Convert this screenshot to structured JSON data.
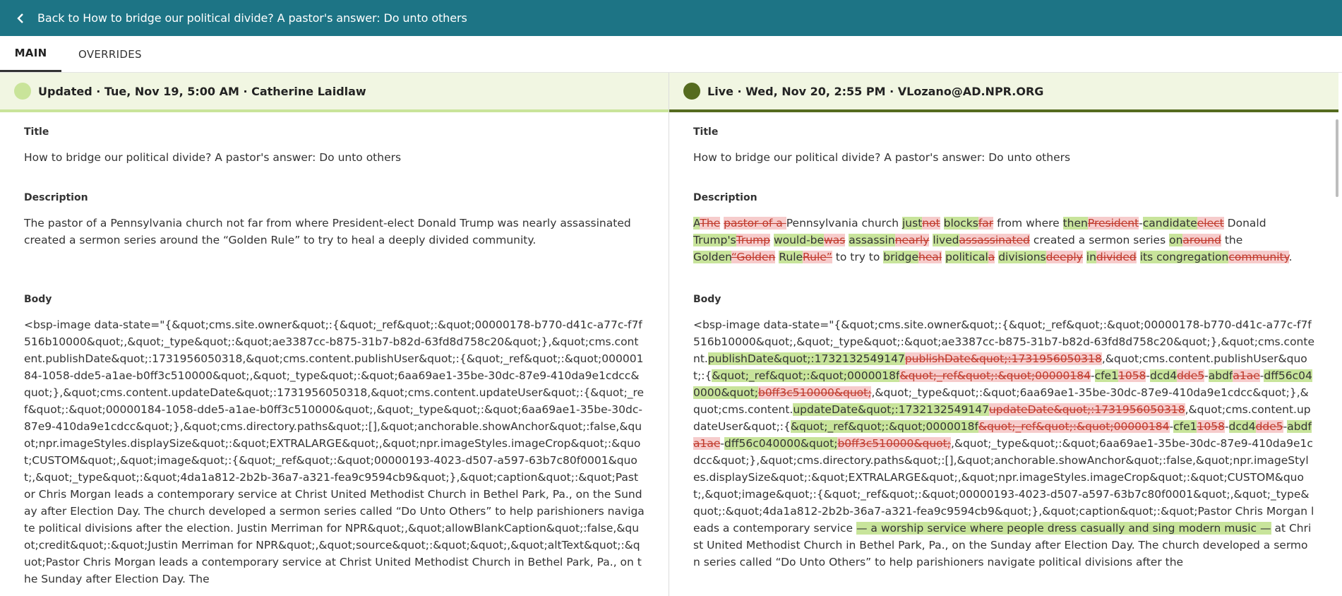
{
  "header": {
    "back_label": "Back to How to bridge our political divide? A pastor's answer: Do unto others"
  },
  "tabs": [
    {
      "label": "MAIN"
    },
    {
      "label": "OVERRIDES"
    }
  ],
  "left": {
    "status": "Updated · Tue, Nov 19, 5:00 AM · Catherine Laidlaw",
    "title_label": "Title",
    "title_value": "How to bridge our political divide? A pastor's answer: Do unto others",
    "description_label": "Description",
    "description_value": "The pastor of a Pennsylvania church not far from where President-elect Donald Trump was nearly assassinated created a sermon series around the “Golden Rule” to try to heal a deeply divided community.",
    "body_label": "Body",
    "body_value": "<bsp-image data-state=\"{&quot;cms.site.owner&quot;:{&quot;_ref&quot;:&quot;00000178-b770-d41c-a77c-f7f516b10000&quot;,&quot;_type&quot;:&quot;ae3387cc-b875-31b7-b82d-63fd8d758c20&quot;},&quot;cms.content.publishDate&quot;:1731956050318,&quot;cms.content.publishUser&quot;:{&quot;_ref&quot;:&quot;00000184-1058-dde5-a1ae-b0ff3c510000&quot;,&quot;_type&quot;:&quot;6aa69ae1-35be-30dc-87e9-410da9e1cdcc&quot;},&quot;cms.content.updateDate&quot;:1731956050318,&quot;cms.content.updateUser&quot;:{&quot;_ref&quot;:&quot;00000184-1058-dde5-a1ae-b0ff3c510000&quot;,&quot;_type&quot;:&quot;6aa69ae1-35be-30dc-87e9-410da9e1cdcc&quot;},&quot;cms.directory.paths&quot;:[],&quot;anchorable.showAnchor&quot;:false,&quot;npr.imageStyles.displaySize&quot;:&quot;EXTRALARGE&quot;,&quot;npr.imageStyles.imageCrop&quot;:&quot;CUSTOM&quot;,&quot;image&quot;:{&quot;_ref&quot;:&quot;00000193-4023-d507-a597-63b7c80f0001&quot;,&quot;_type&quot;:&quot;4da1a812-2b2b-36a7-a321-fea9c9594cb9&quot;},&quot;caption&quot;:&quot;Pastor Chris Morgan leads a contemporary service at Christ United Methodist Church in Bethel Park, Pa., on the Sunday after Election Day. The church developed a sermon series called “Do Unto Others” to help parishioners navigate political divisions after the election. Justin Merriman for NPR&quot;,&quot;allowBlankCaption&quot;:false,&quot;credit&quot;:&quot;Justin Merriman for NPR&quot;,&quot;source&quot;:&quot;&quot;,&quot;altText&quot;:&quot;Pastor Chris Morgan leads a contemporary service at Christ United Methodist Church in Bethel Park, Pa., on the Sunday after Election Day. The"
  },
  "right": {
    "status": "Live · Wed, Nov 20, 2:55 PM · VLozano@AD.NPR.ORG",
    "title_label": "Title",
    "title_value": "How to bridge our political divide? A pastor's answer: Do unto others",
    "description_label": "Description",
    "description_diff": [
      {
        "t": "ins",
        "v": "A"
      },
      {
        "t": "del",
        "v": "The"
      },
      {
        "t": "eq",
        "v": " "
      },
      {
        "t": "del",
        "v": "pastor of a "
      },
      {
        "t": "eq",
        "v": "Pennsylvania church "
      },
      {
        "t": "ins",
        "v": "just"
      },
      {
        "t": "del",
        "v": "not"
      },
      {
        "t": "eq",
        "v": " "
      },
      {
        "t": "ins",
        "v": "blocks"
      },
      {
        "t": "del",
        "v": "far"
      },
      {
        "t": "eq",
        "v": " from where "
      },
      {
        "t": "ins",
        "v": "then"
      },
      {
        "t": "del",
        "v": "President"
      },
      {
        "t": "eq",
        "v": "-"
      },
      {
        "t": "ins",
        "v": "candidate"
      },
      {
        "t": "del",
        "v": "elect"
      },
      {
        "t": "eq",
        "v": " Donald "
      },
      {
        "t": "ins",
        "v": "Trump's"
      },
      {
        "t": "del",
        "v": "Trump"
      },
      {
        "t": "eq",
        "v": " "
      },
      {
        "t": "ins",
        "v": "would-be"
      },
      {
        "t": "del",
        "v": "was"
      },
      {
        "t": "eq",
        "v": " "
      },
      {
        "t": "ins",
        "v": "assassin"
      },
      {
        "t": "del",
        "v": "nearly"
      },
      {
        "t": "eq",
        "v": " "
      },
      {
        "t": "ins",
        "v": "lived"
      },
      {
        "t": "del",
        "v": "assassinated"
      },
      {
        "t": "eq",
        "v": " created a sermon series "
      },
      {
        "t": "ins",
        "v": "on"
      },
      {
        "t": "del",
        "v": "around"
      },
      {
        "t": "eq",
        "v": " the "
      },
      {
        "t": "ins",
        "v": "Golden"
      },
      {
        "t": "del",
        "v": "“Golden"
      },
      {
        "t": "eq",
        "v": " "
      },
      {
        "t": "ins",
        "v": "Rule"
      },
      {
        "t": "del",
        "v": "Rule”"
      },
      {
        "t": "eq",
        "v": " to try to "
      },
      {
        "t": "ins",
        "v": "bridge"
      },
      {
        "t": "del",
        "v": "heal"
      },
      {
        "t": "eq",
        "v": " "
      },
      {
        "t": "ins",
        "v": "political"
      },
      {
        "t": "del",
        "v": "a"
      },
      {
        "t": "eq",
        "v": " "
      },
      {
        "t": "ins",
        "v": "divisions"
      },
      {
        "t": "del",
        "v": "deeply"
      },
      {
        "t": "eq",
        "v": " "
      },
      {
        "t": "ins",
        "v": "in"
      },
      {
        "t": "del",
        "v": "divided"
      },
      {
        "t": "eq",
        "v": " "
      },
      {
        "t": "ins",
        "v": "its congregation"
      },
      {
        "t": "del",
        "v": "community"
      },
      {
        "t": "eq",
        "v": "."
      }
    ],
    "body_label": "Body",
    "body_diff": [
      {
        "t": "eq",
        "v": "<bsp-image data-state=\"{&quot;cms.site.owner&quot;:{&quot;_ref&quot;:&quot;00000178-b770-d41c-a77c-f7f516b10000&quot;,&quot;_type&quot;:&quot;ae3387cc-b875-31b7-b82d-63fd8d758c20&quot;},&quot;cms.content."
      },
      {
        "t": "ins",
        "v": "publishDate&quot;:1732132549147"
      },
      {
        "t": "del",
        "v": "publishDate&quot;:1731956050318"
      },
      {
        "t": "eq",
        "v": ",&quot;cms.content.publishUser&quot;:{"
      },
      {
        "t": "ins",
        "v": "&quot;_ref&quot;:&quot;0000018f"
      },
      {
        "t": "del",
        "v": "&quot;_ref&quot;:&quot;00000184"
      },
      {
        "t": "eq",
        "v": "-"
      },
      {
        "t": "ins",
        "v": "cfe1"
      },
      {
        "t": "del",
        "v": "1058"
      },
      {
        "t": "eq",
        "v": "-"
      },
      {
        "t": "ins",
        "v": "dcd4"
      },
      {
        "t": "del",
        "v": "dde5"
      },
      {
        "t": "eq",
        "v": "-"
      },
      {
        "t": "ins",
        "v": "abdf"
      },
      {
        "t": "del",
        "v": "a1ae"
      },
      {
        "t": "eq",
        "v": "-"
      },
      {
        "t": "ins",
        "v": "dff56c040000&quot;"
      },
      {
        "t": "del",
        "v": "b0ff3c510000&quot;"
      },
      {
        "t": "eq",
        "v": ",&quot;_type&quot;:&quot;6aa69ae1-35be-30dc-87e9-410da9e1cdcc&quot;},&quot;cms.content."
      },
      {
        "t": "ins",
        "v": "updateDate&quot;:1732132549147"
      },
      {
        "t": "del",
        "v": "updateDate&quot;:1731956050318"
      },
      {
        "t": "eq",
        "v": ",&quot;cms.content.updateUser&quot;:{"
      },
      {
        "t": "ins",
        "v": "&quot;_ref&quot;:&quot;0000018f"
      },
      {
        "t": "del",
        "v": "&quot;_ref&quot;:&quot;00000184"
      },
      {
        "t": "eq",
        "v": "-"
      },
      {
        "t": "ins",
        "v": "cfe1"
      },
      {
        "t": "del",
        "v": "1058"
      },
      {
        "t": "eq",
        "v": "-"
      },
      {
        "t": "ins",
        "v": "dcd4"
      },
      {
        "t": "del",
        "v": "dde5"
      },
      {
        "t": "eq",
        "v": "-"
      },
      {
        "t": "ins",
        "v": "abdf"
      },
      {
        "t": "del",
        "v": "a1ae"
      },
      {
        "t": "eq",
        "v": "-"
      },
      {
        "t": "ins",
        "v": "dff56c040000&quot;"
      },
      {
        "t": "del",
        "v": "b0ff3c510000&quot;"
      },
      {
        "t": "eq",
        "v": ",&quot;_type&quot;:&quot;6aa69ae1-35be-30dc-87e9-410da9e1cdcc&quot;},&quot;cms.directory.paths&quot;:[],&quot;anchorable.showAnchor&quot;:false,&quot;npr.imageStyles.displaySize&quot;:&quot;EXTRALARGE&quot;,&quot;npr.imageStyles.imageCrop&quot;:&quot;CUSTOM&quot;,&quot;image&quot;:{&quot;_ref&quot;:&quot;00000193-4023-d507-a597-63b7c80f0001&quot;,&quot;_type&quot;:&quot;4da1a812-2b2b-36a7-a321-fea9c9594cb9&quot;},&quot;caption&quot;:&quot;Pastor Chris Morgan leads a contemporary service "
      },
      {
        "t": "ins",
        "v": "— a worship service where people dress casually and sing modern music —"
      },
      {
        "t": "eq",
        "v": " at Christ United Methodist Church in Bethel Park, Pa., on the Sunday after Election Day. The church developed a sermon series called “Do Unto Others” to help parishioners navigate political divisions after the"
      }
    ]
  },
  "colors": {
    "topbar": "#1d7485",
    "inserted": "#c8e49b",
    "deleted": "#f6cccc",
    "updated_dot": "#c9e49a",
    "live_dot": "#556b1f"
  }
}
